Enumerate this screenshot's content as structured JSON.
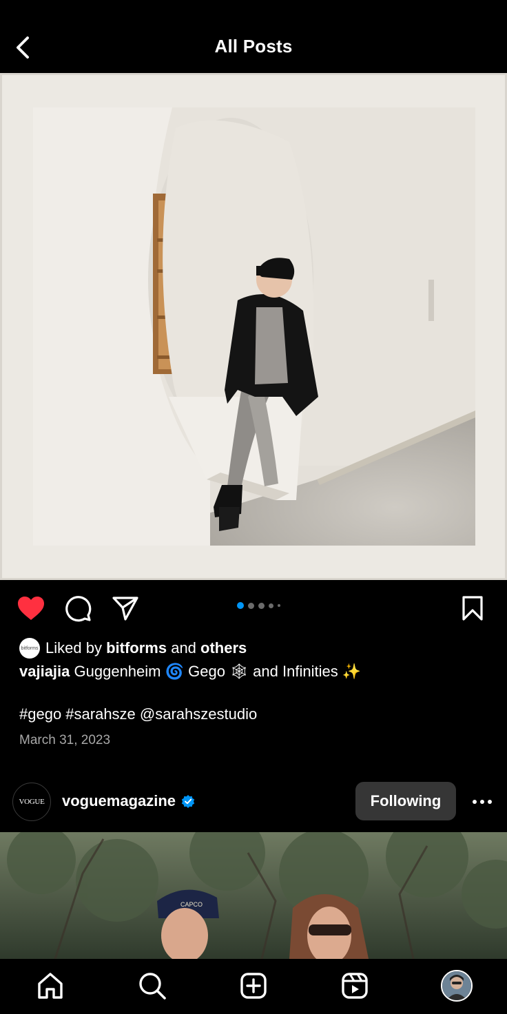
{
  "header": {
    "title": "All Posts",
    "back_icon": "chevron-left-icon"
  },
  "post": {
    "liked": true,
    "like_color": "#ff3040",
    "carousel": {
      "total": 5,
      "active": 1,
      "active_color": "#0095f6"
    },
    "liked_by": {
      "avatar_text": "bitforms",
      "prefix": "Liked by",
      "user": "bitforms",
      "conjunction": "and",
      "others": "others"
    },
    "caption": {
      "username": "vajiajia",
      "text_part1": "Guggenheim",
      "emoji1": "🌀",
      "text_part2": "Gego",
      "emoji2": "🕸",
      "text_part3": "and Infinities",
      "emoji3": "✨"
    },
    "hashtags": "#gego #sarahsze @sarahszestudio",
    "date": "March 31, 2023"
  },
  "next_post": {
    "avatar_text": "VOGUE",
    "username": "voguemagazine",
    "verified": true,
    "verified_color": "#0095f6",
    "follow_button": "Following"
  },
  "bottom_nav": {
    "items": [
      {
        "name": "home",
        "icon": "home-icon"
      },
      {
        "name": "search",
        "icon": "search-icon"
      },
      {
        "name": "create",
        "icon": "plus-square-icon"
      },
      {
        "name": "reels",
        "icon": "reels-icon"
      },
      {
        "name": "profile",
        "icon": "avatar"
      }
    ]
  }
}
